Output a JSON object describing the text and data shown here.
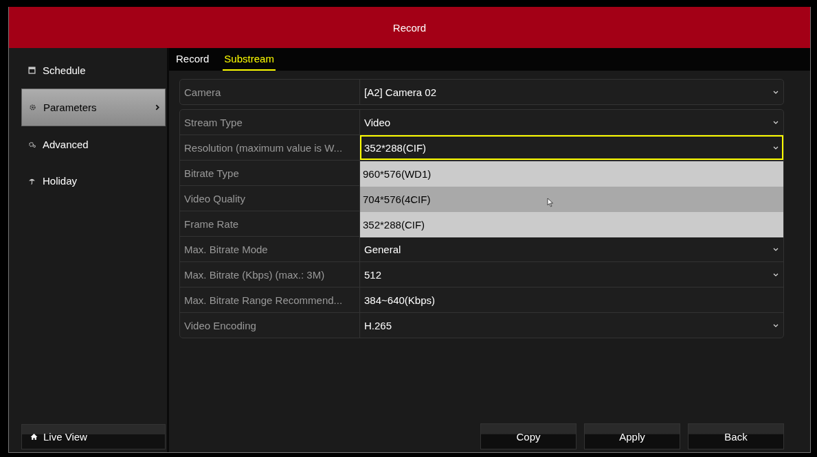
{
  "window": {
    "title": "Record"
  },
  "sidebar": {
    "items": [
      {
        "label": "Schedule",
        "selected": false
      },
      {
        "label": "Parameters",
        "selected": true
      },
      {
        "label": "Advanced",
        "selected": false
      },
      {
        "label": "Holiday",
        "selected": false
      }
    ],
    "footer": {
      "label": "Live View"
    }
  },
  "tabs": [
    {
      "label": "Record",
      "selected": false
    },
    {
      "label": "Substream",
      "selected": true
    }
  ],
  "camera": {
    "label": "Camera",
    "value": "[A2] Camera 02"
  },
  "settings": [
    {
      "label": "Stream Type",
      "kind": "select",
      "value": "Video",
      "focused": false
    },
    {
      "label": "Resolution (maximum value is W...",
      "kind": "select",
      "value": "352*288(CIF)",
      "focused": true,
      "options": [
        {
          "label": "960*576(WD1)",
          "highlighted": false
        },
        {
          "label": "704*576(4CIF)",
          "highlighted": true
        },
        {
          "label": "352*288(CIF)",
          "highlighted": false
        }
      ]
    },
    {
      "label": "Bitrate Type",
      "kind": "hidden"
    },
    {
      "label": "Video Quality",
      "kind": "hidden"
    },
    {
      "label": "Frame Rate",
      "kind": "hidden"
    },
    {
      "label": "Max. Bitrate Mode",
      "kind": "select",
      "value": "General",
      "focused": false
    },
    {
      "label": "Max. Bitrate (Kbps) (max.: 3M)",
      "kind": "select",
      "value": "512",
      "focused": false
    },
    {
      "label": "Max. Bitrate Range Recommend...",
      "kind": "text",
      "value": "384~640(Kbps)"
    },
    {
      "label": "Video Encoding",
      "kind": "select",
      "value": "H.265",
      "focused": false
    }
  ],
  "buttons": [
    "Copy",
    "Apply",
    "Back"
  ]
}
